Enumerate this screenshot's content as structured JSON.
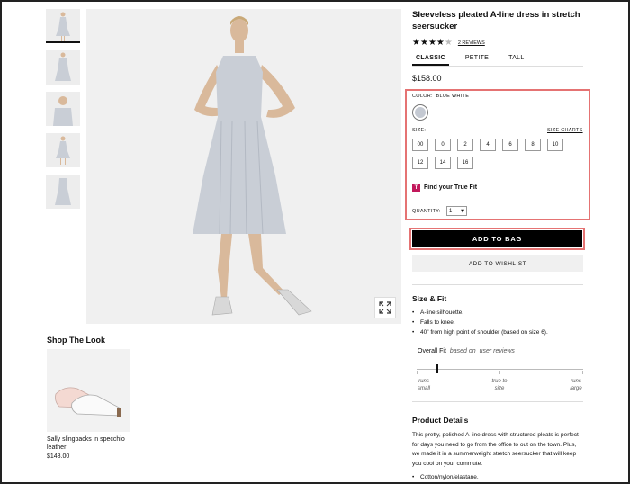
{
  "product": {
    "title": "Sleeveless pleated A-line dress in stretch seersucker",
    "rating_stars_filled": 4,
    "rating_stars_total": 5,
    "reviews_link": "2 REVIEWS",
    "fit_tabs": [
      "CLASSIC",
      "PETITE",
      "TALL"
    ],
    "active_fit_tab": "CLASSIC",
    "price": "$158.00"
  },
  "variants": {
    "color_label": "COLOR:",
    "color_value": "BLUE WHITE",
    "swatch_color": "#c4c9d2",
    "size_label": "SIZE:",
    "size_charts_link": "SIZE CHARTS",
    "sizes": [
      "00",
      "0",
      "2",
      "4",
      "6",
      "8",
      "10",
      "12",
      "14",
      "16"
    ],
    "truefit_logo": "T",
    "truefit_text": "Find your True Fit",
    "quantity_label": "QUANTITY:",
    "quantity_value": "1",
    "quantity_arrow": "▼"
  },
  "actions": {
    "add_to_bag": "ADD TO BAG",
    "add_to_wishlist": "ADD TO WISHLIST"
  },
  "size_fit": {
    "title": "Size & Fit",
    "bullets": [
      "A-line silhouette.",
      "Falls to knee.",
      "40\" from high point of shoulder (based on size 6)."
    ],
    "overall_fit_label": "Overall Fit",
    "based_on": "based on",
    "user_reviews_link": "user reviews",
    "fit_level": 0.12,
    "scale_left": [
      "runs",
      "small"
    ],
    "scale_mid": [
      "true to",
      "size"
    ],
    "scale_right": [
      "runs",
      "large"
    ]
  },
  "product_details": {
    "title": "Product Details",
    "description": "This pretty, polished A-line dress with structured pleats is perfect for days you need to go from the office to out on the town. Plus, we made it in a summerweight stretch seersucker that will keep you cool on your commute.",
    "bullets": [
      "Cotton/nylon/elastane."
    ]
  },
  "shop_the_look": {
    "title": "Shop The Look",
    "item_name": "Sally slingbacks in specchio leather",
    "item_price": "$148.00"
  },
  "colors": {
    "accent_outline": "#e57373",
    "truefit_brand": "#c2185b",
    "dress": "#c9ced6"
  }
}
